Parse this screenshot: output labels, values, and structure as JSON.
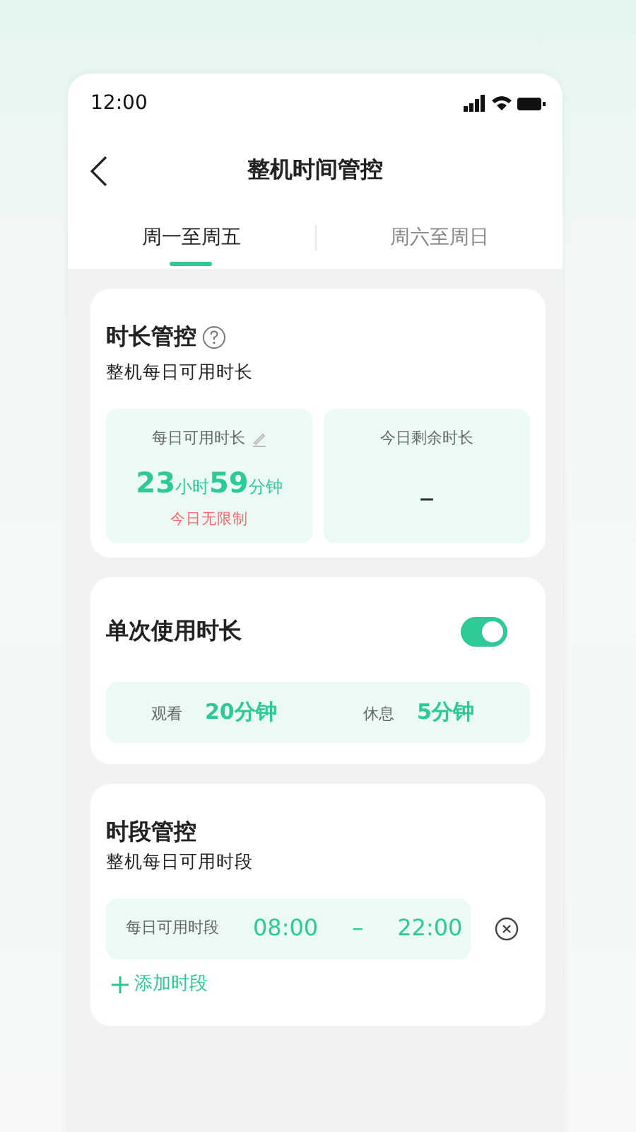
{
  "status_bar": {
    "time": "12:00"
  },
  "header": {
    "title": "整机时间管控"
  },
  "tabs": [
    {
      "label": "周一至周五",
      "selected": true
    },
    {
      "label": "周六至周日",
      "selected": false
    }
  ],
  "duration_control": {
    "title": "时长管控",
    "subtitle": "整机每日可用时长",
    "stats": [
      {
        "label": "每日可用时长",
        "editable": true,
        "value_parts": [
          {
            "kind": "number",
            "text": "23"
          },
          {
            "kind": "unit",
            "text": "小时"
          },
          {
            "kind": "number",
            "text": "59"
          },
          {
            "kind": "unit",
            "text": "分钟"
          }
        ],
        "note": "今日无限制"
      },
      {
        "label": "今日剩余时长",
        "editable": false,
        "value_parts": [
          {
            "kind": "dash",
            "text": "–"
          }
        ]
      }
    ]
  },
  "single_use": {
    "title": "单次使用时长",
    "on": true,
    "items": [
      {
        "label": "观看",
        "value": "20分钟"
      },
      {
        "label": "休息",
        "value": "5分钟"
      }
    ]
  },
  "period_control": {
    "title": "时段管控",
    "subtitle": "整机每日可用时段",
    "ranges": [
      {
        "label": "每日可用时段",
        "start": "08:00",
        "separator": "–",
        "end": "22:00"
      }
    ],
    "add_label": "添加时段"
  }
}
